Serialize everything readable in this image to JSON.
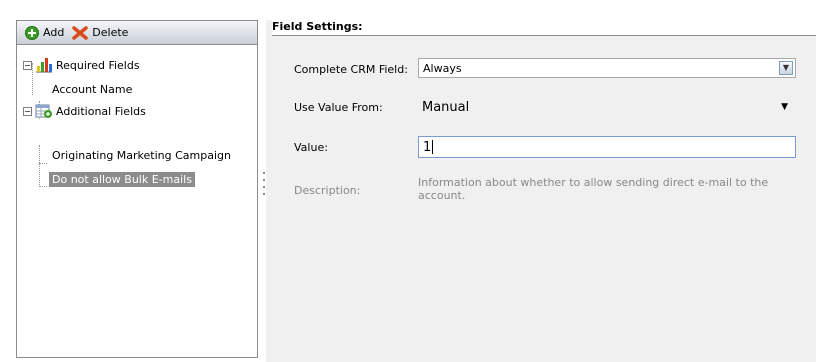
{
  "toolbar": {
    "add_label": "Add",
    "delete_label": "Delete"
  },
  "tree": {
    "groups": [
      {
        "label": "Required Fields",
        "children": [
          "Account Name"
        ]
      },
      {
        "label": "Additional Fields",
        "children": [
          "Originating Marketing Campaign",
          "Do not allow Bulk E-mails"
        ]
      }
    ],
    "selected": "Do not allow Bulk E-mails"
  },
  "settings": {
    "title": "Field Settings:",
    "complete_label": "Complete CRM Field:",
    "complete_value": "Always",
    "use_value_label": "Use Value From:",
    "use_value_value": "Manual",
    "value_label": "Value:",
    "value_value": "1",
    "description_label": "Description:",
    "description_text": "Information about whether to allow sending direct e-mail to the account."
  },
  "colors": {
    "selected_bg": "#8c8c8c",
    "panel_bg": "#f0f0f0",
    "input_border": "#7a9cd3"
  }
}
